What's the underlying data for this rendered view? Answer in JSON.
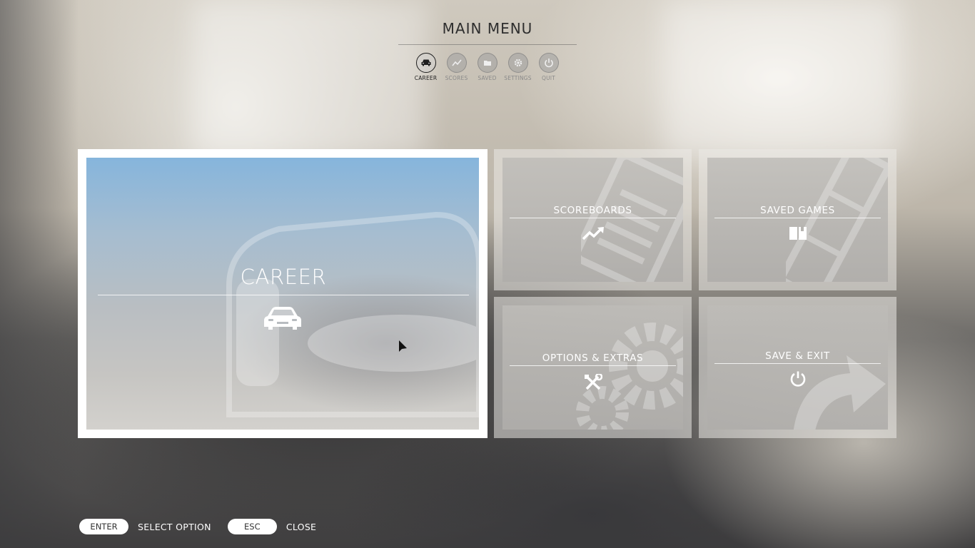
{
  "header": {
    "title": "MAIN MENU"
  },
  "tabs": [
    {
      "label": "CAREER",
      "icon": "car-icon",
      "active": true
    },
    {
      "label": "SCORES",
      "icon": "trend-icon",
      "active": false
    },
    {
      "label": "SAVED",
      "icon": "folder-icon",
      "active": false
    },
    {
      "label": "SETTINGS",
      "icon": "gear-icon",
      "active": false
    },
    {
      "label": "QUIT",
      "icon": "power-icon",
      "active": false
    }
  ],
  "tiles": {
    "career": {
      "label": "CAREER",
      "icon": "car-icon",
      "selected": true
    },
    "scoreboards": {
      "label": "SCOREBOARDS",
      "icon": "trend-up-icon"
    },
    "saved_games": {
      "label": "SAVED GAMES",
      "icon": "book-icon"
    },
    "options": {
      "label": "OPTIONS & EXTRAS",
      "icon": "tools-icon"
    },
    "save_exit": {
      "label": "SAVE & EXIT",
      "icon": "power-icon"
    }
  },
  "footer": {
    "enter_key": "ENTER",
    "enter_action": "SELECT OPTION",
    "esc_key": "ESC",
    "esc_action": "CLOSE"
  },
  "colors": {
    "selected_frame": "#ffffff",
    "tile_text": "#ffffff",
    "title_text": "#2e2e2e"
  }
}
